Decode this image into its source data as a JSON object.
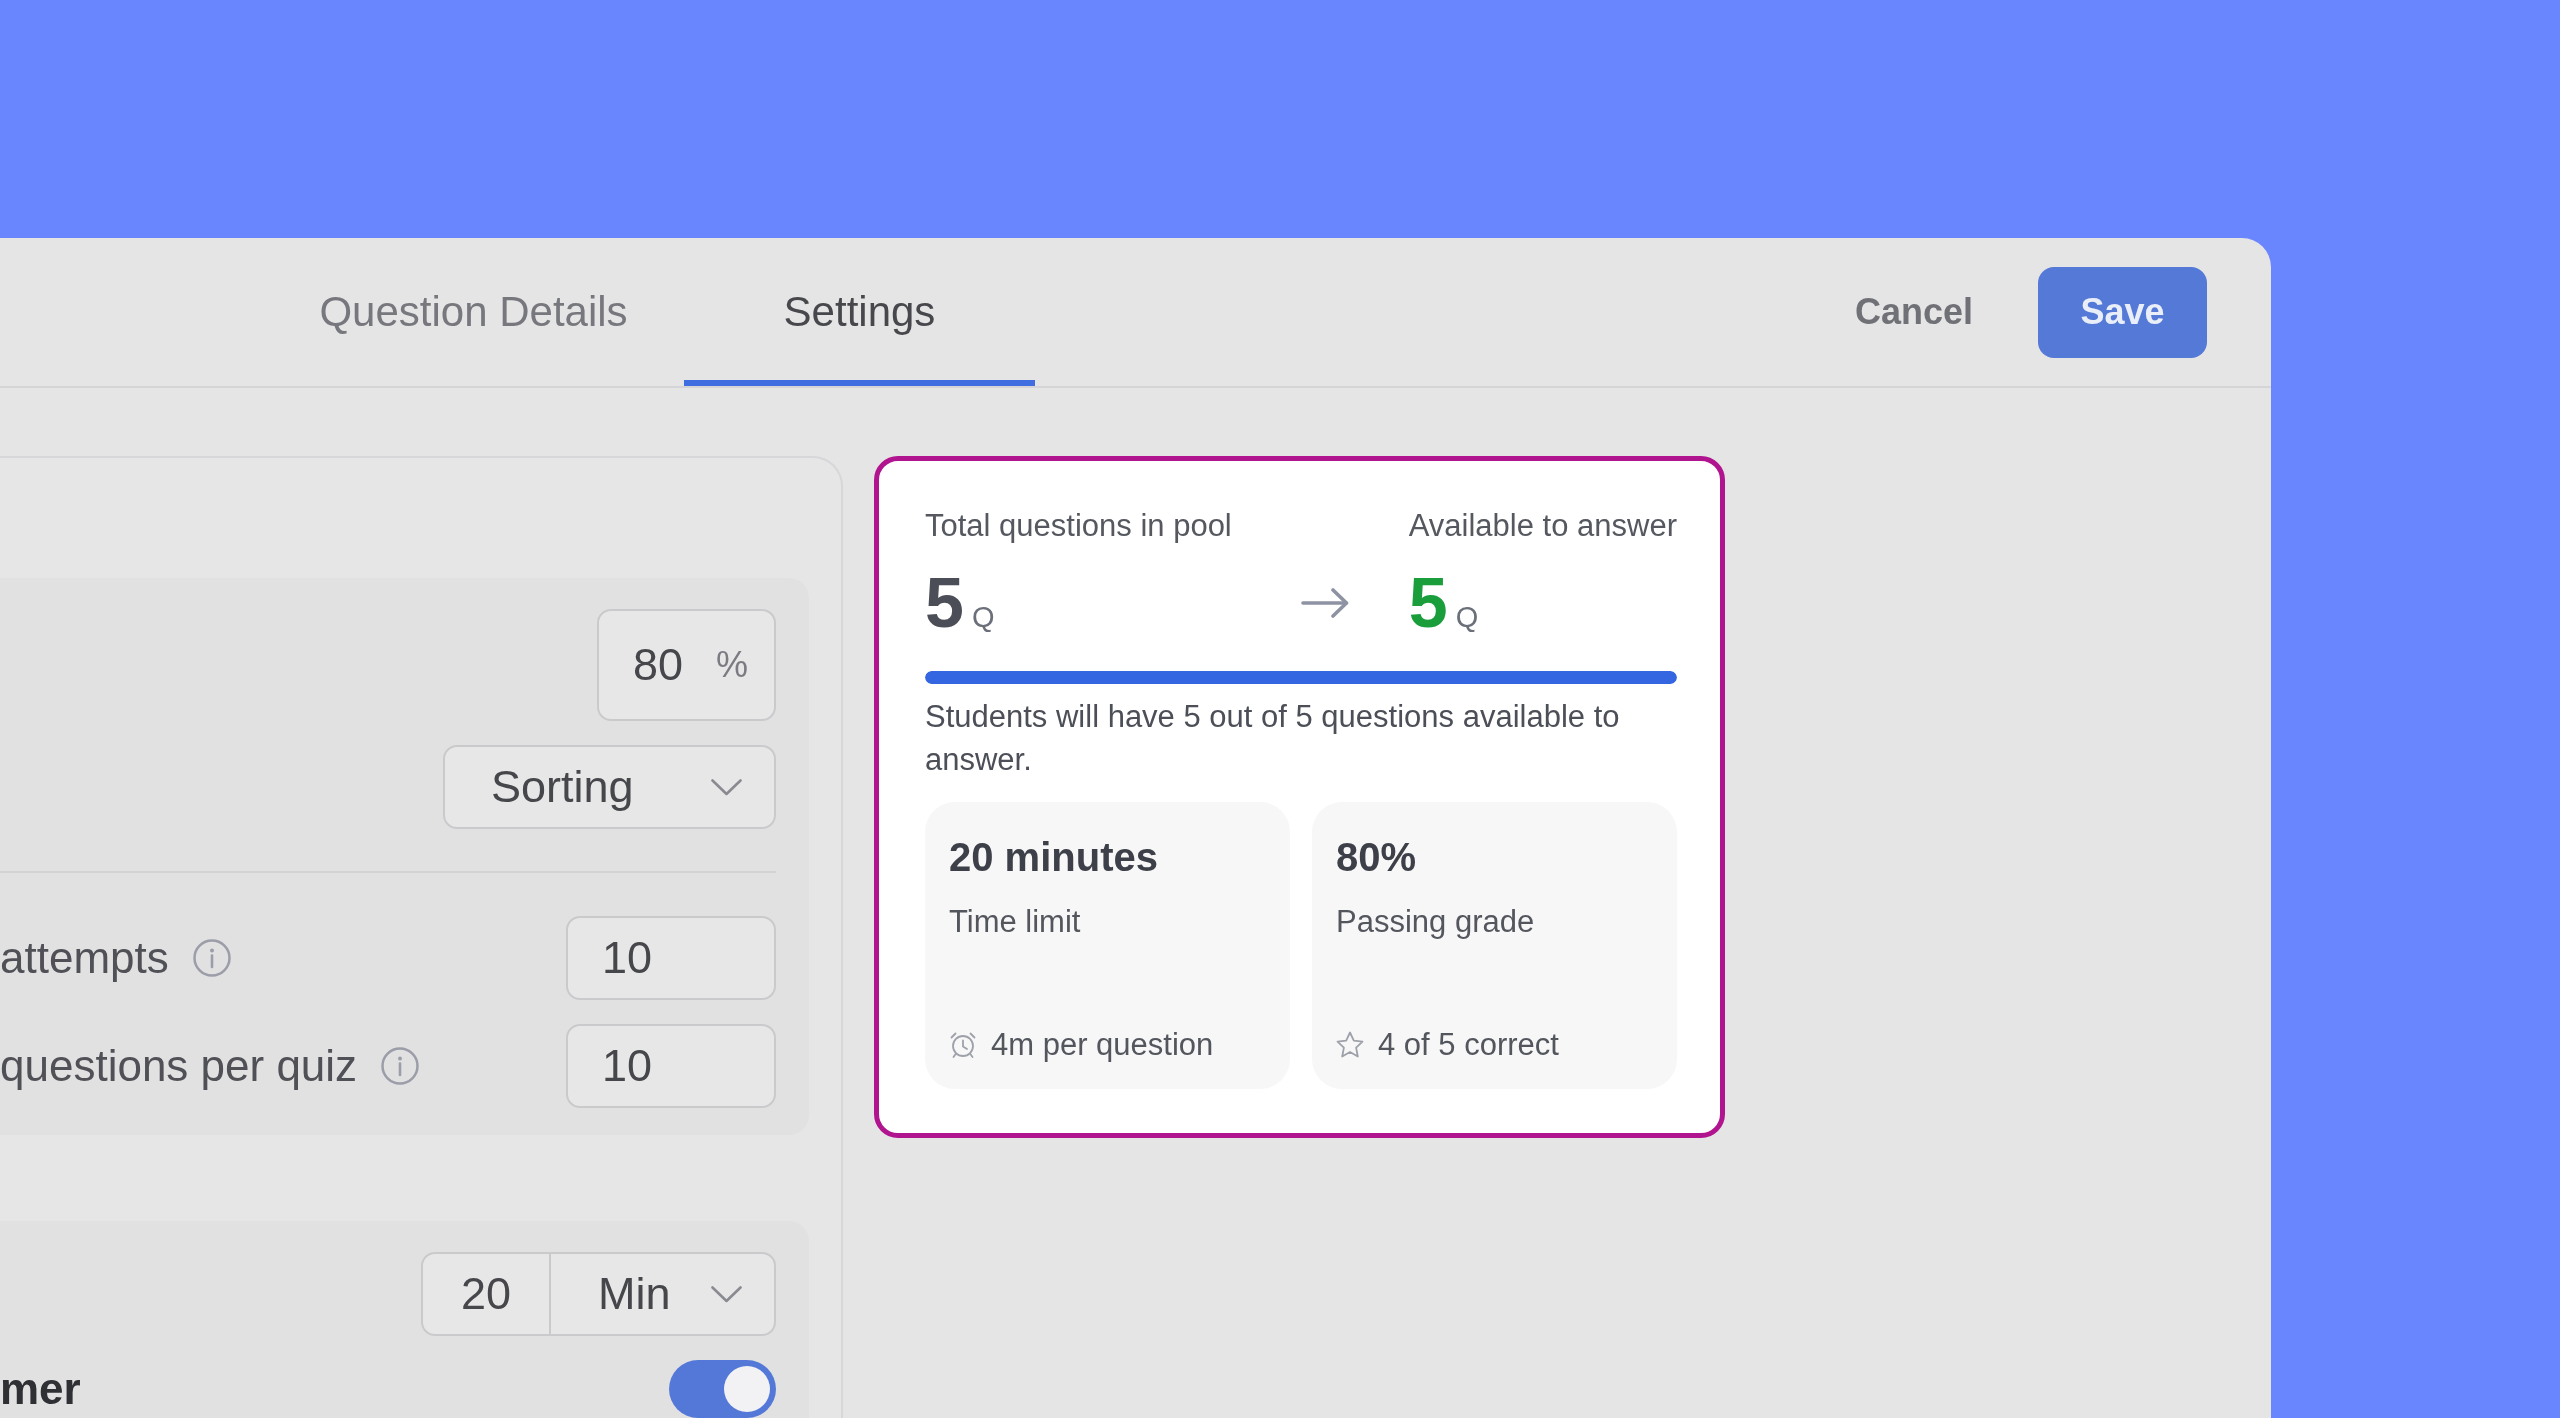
{
  "tabs": [
    {
      "label": "Question Details",
      "selected": false
    },
    {
      "label": "Settings",
      "selected": true
    }
  ],
  "actions": [
    {
      "kind": "text",
      "label": "Cancel"
    },
    {
      "kind": "primary",
      "label": "Save"
    }
  ],
  "settings_panel": {
    "blocks": [
      {
        "groups": [
          [
            {
              "kind": "percent",
              "value": "80",
              "unit": "%"
            },
            {
              "kind": "dropdown",
              "value": "Sorting"
            }
          ],
          [
            {
              "kind": "number",
              "label": "attempts",
              "info": true,
              "value": "10"
            },
            {
              "kind": "number",
              "label": "questions per quiz",
              "info": true,
              "value": "10"
            }
          ]
        ]
      },
      {
        "groups": [
          [
            {
              "kind": "duration",
              "value": "20",
              "unit": "Min"
            },
            {
              "kind": "toggle",
              "label": "mer",
              "on": true
            }
          ]
        ]
      }
    ]
  },
  "summary_card": {
    "highlighted": true,
    "pool": {
      "label": "Total questions in pool",
      "count": "5",
      "unit": "Q"
    },
    "available": {
      "label": "Available to answer",
      "count": "5",
      "unit": "Q"
    },
    "level": 1,
    "message": "Students will have 5 out of 5 questions available to answer.",
    "stats": [
      {
        "kind": "time",
        "value": "20 minutes",
        "label": "Time limit",
        "note": "4m per question"
      },
      {
        "kind": "grade",
        "value": "80%",
        "label": "Passing grade",
        "note": "4 of 5 correct"
      }
    ]
  }
}
